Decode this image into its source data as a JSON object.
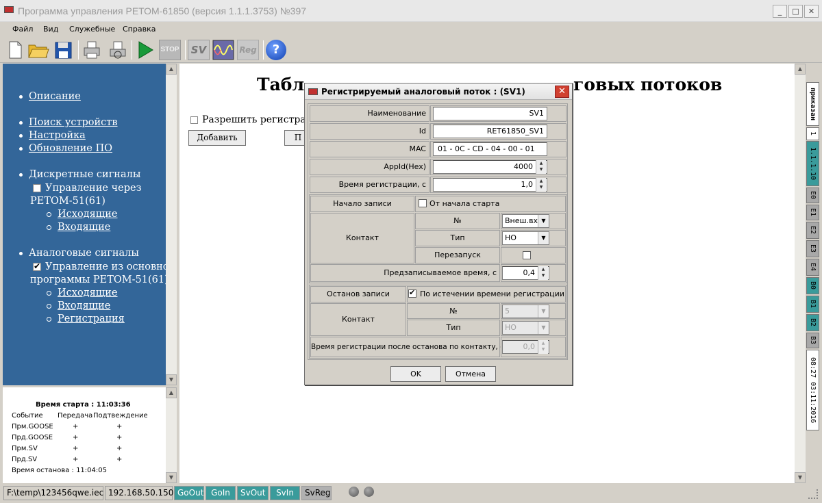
{
  "window": {
    "title": "Программа управления РЕТОМ-61850 (версия 1.1.1.3753) №397",
    "min": "_",
    "max": "□",
    "close": "✕"
  },
  "menu": [
    "Файл",
    "Вид",
    "Служебные",
    "Справка"
  ],
  "toolbar": {
    "stop_label": "STOP",
    "sv_label": "SV",
    "reg_label": "Reg",
    "help_label": "?"
  },
  "sidebar": {
    "opisanie": "Описание",
    "poisk": "Поиск устройств",
    "nastroika": "Настройка",
    "obnovlenie": "Обновление ПО",
    "discrete": "Дискретные сигналы",
    "discrete_ctrl_1": "Управление через",
    "discrete_ctrl_2": "РЕТОМ-51(61)",
    "discrete_out": "Исходящие",
    "discrete_in": "Входящие",
    "analog": "Аналоговые сигналы",
    "analog_ctrl_1": "Управление из основной",
    "analog_ctrl_2": "программы РЕТОМ-51(61)",
    "analog_out": "Исходящие",
    "analog_in": "Входящие",
    "analog_reg": "Регистрация"
  },
  "info": {
    "start_time": "Время старта : 11:03:36",
    "col_event": "Событие",
    "col_tx": "Передача",
    "col_ack": "Подтвеждение",
    "rows": [
      {
        "event": "Прм.GOOSE",
        "tx": "+",
        "ack": "+"
      },
      {
        "event": "Прд.GOOSE",
        "tx": "+",
        "ack": "+"
      },
      {
        "event": "Прм.SV",
        "tx": "+",
        "ack": "+"
      },
      {
        "event": "Прд.SV",
        "tx": "+",
        "ack": "+"
      }
    ],
    "stop_time": "Время останова : 11:04:05"
  },
  "main": {
    "heading_left": "Табл",
    "heading_right": "говых потоков",
    "allow_reg": "Разрешить регистрац",
    "add_button": "Добавить",
    "second_button": "П"
  },
  "status": {
    "path": "F:\\temp\\123456qwe.iec",
    "ip": "192.168.50.150",
    "goout": "GoOut",
    "goin": "GoIn",
    "svout": "SvOut",
    "svin": "SvIn",
    "svreg": "SvReg"
  },
  "right_tabs": {
    "prikazan": "приказан",
    "t1": "1",
    "version": "1.1.1.10",
    "e0": "E0",
    "e1": "E1",
    "e2": "E2",
    "e3": "E3",
    "e4": "E4",
    "b0": "B0",
    "b1": "B1",
    "b2": "B2",
    "b3": "B3",
    "datetime": "08:27 03:11:2016"
  },
  "dialog": {
    "title": "Регистрируемый аналоговый поток : (SV1)",
    "name_label": "Наименование",
    "name_value": "SV1",
    "id_label": "Id",
    "id_value": "RET61850_SV1",
    "mac_label": "MAC",
    "mac_value": "01 - 0C - CD - 04 - 00 - 01",
    "appid_label": "AppId(Hex)",
    "appid_value": "4000",
    "regtime_label": "Время регистрации, с",
    "regtime_value": "1,0",
    "start_label": "Начало записи",
    "from_start_label": "От начала старта",
    "contact_label": "Контакт",
    "num_label": "№",
    "num_value": "Внеш.вх.1",
    "type_label": "Тип",
    "type_value": "НО",
    "restart_label": "Перезапуск",
    "prerec_label": "Предзаписываемое время, с",
    "prerec_value": "0,4",
    "stop_label": "Останов записи",
    "on_expire_label": "По истечении времени регистрации",
    "contact2_label": "Контакт",
    "num2_label": "№",
    "num2_value": "5",
    "type2_label": "Тип",
    "type2_value": "НО",
    "afterstop_label": "Время регистрации после останова по контакту, с",
    "afterstop_value": "0,0",
    "ok": "OK",
    "cancel": "Отмена"
  }
}
